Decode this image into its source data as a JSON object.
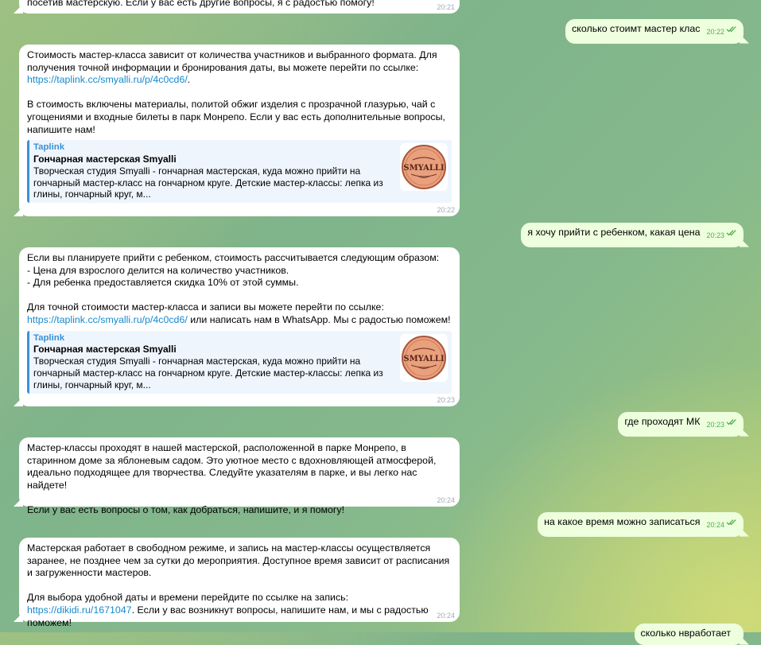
{
  "messages": [
    {
      "from": "in",
      "text": "посетив мастерскую. Если у вас есть другие вопросы, я с радостью помогу!",
      "time": "20:21"
    },
    {
      "from": "out",
      "text": "сколько стоимт мастер клас",
      "time": "20:22"
    },
    {
      "from": "in",
      "parts": [
        {
          "t": "Стоимость мастер-класса зависит от количества участников и выбранного формата. Для получения точной информации и бронирования даты, вы можете перейти по ссылке: "
        },
        {
          "t": "https://taplink.cc/smyalli.ru/p/4c0cd6/",
          "link": true
        },
        {
          "t": ".\n\nВ стоимость включены материалы, политой обжиг изделия с прозрачной глазурью, чай с угощениями и входные билеты в парк Монрепо. Если у вас есть дополнительные вопросы, напишите нам!"
        }
      ],
      "preview": {
        "site": "Taplink",
        "title": "Гончарная мастерская Smyalli",
        "desc": "Творческая студия Smyalli - гончарная мастерская, куда можно прийти на гончарный мастер-класс на гончарном круге. Детские мастер-классы: лепка из глины, гончарный круг, м...",
        "logo_text": "SMYALLI"
      },
      "time": "20:22"
    },
    {
      "from": "out",
      "text": "я хочу прийти с ребенком, какая цена",
      "time": "20:23"
    },
    {
      "from": "in",
      "parts": [
        {
          "t": "Если вы планируете прийти с ребенком, стоимость рассчитывается следующим образом:\n- Цена для взрослого делится на количество участников.\n- Для ребенка предоставляется скидка 10% от этой суммы.\n\nДля точной стоимости мастер-класса и записи вы можете перейти по ссылке: "
        },
        {
          "t": "https://taplink.cc/smyalli.ru/p/4c0cd6/",
          "link": true
        },
        {
          "t": " или написать нам в WhatsApp. Мы с радостью поможем!"
        }
      ],
      "preview": {
        "site": "Taplink",
        "title": "Гончарная мастерская Smyalli",
        "desc": "Творческая студия Smyalli - гончарная мастерская, куда можно прийти на гончарный мастер-класс на гончарном круге. Детские мастер-классы: лепка из глины, гончарный круг, м...",
        "logo_text": "SMYALLI"
      },
      "time": "20:23"
    },
    {
      "from": "out",
      "text": "где проходят МК",
      "time": "20:23"
    },
    {
      "from": "in",
      "parts": [
        {
          "t": "Мастер-классы проходят в нашей мастерской, расположенной в парке Монрепо, в старинном доме за яблоневым садом. Это уютное место с вдохновляющей атмосферой, идеально подходящее для творчества. Следуйте указателям в парке, и вы легко нас найдете!\n\nЕсли у вас есть вопросы о том, как добраться, напишите, и я помогу!"
        }
      ],
      "time": "20:24"
    },
    {
      "from": "out",
      "text": "на какое время можно записаться",
      "time": "20:24"
    },
    {
      "from": "in",
      "parts": [
        {
          "t": "Мастерская работает в свободном режиме, и запись на мастер-классы осуществляется заранее, не позднее чем за сутки до мероприятия. Доступное время зависит от расписания и загруженности мастеров.\n\nДля выбора удобной даты и времени перейдите по ссылке на запись: "
        },
        {
          "t": "https://dikidi.ru/1671047",
          "link": true
        },
        {
          "t": ". Если у вас возникнут вопросы, напишите нам, и мы с радостью поможем!"
        }
      ],
      "time": "20:24"
    },
    {
      "from": "out",
      "text": "сколько нвработает",
      "time": ""
    }
  ],
  "colors": {
    "incoming": "#ffffff",
    "outgoing": "#eeffde",
    "link": "#168acd",
    "time_out": "#4fae4e",
    "time_in": "#a0acb6"
  },
  "icons": {
    "read_receipt": "double-check-icon"
  }
}
